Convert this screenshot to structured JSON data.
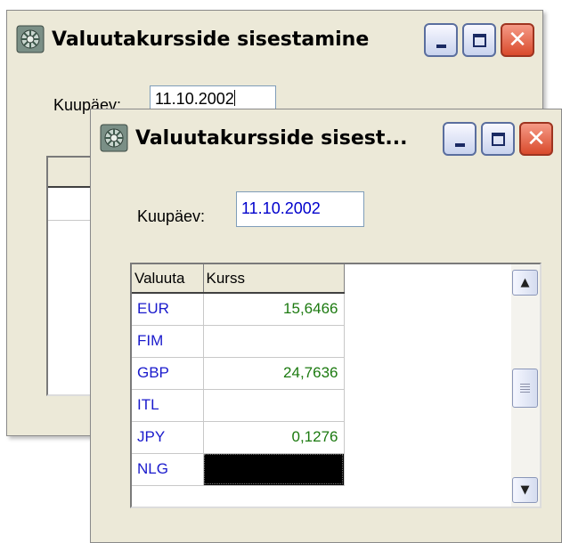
{
  "back_window": {
    "title": "Valuutakursside sisestamine",
    "date_label": "Kuupäev:",
    "date_value": "11.10.2002"
  },
  "front_window": {
    "title": "Valuutakursside sisest...",
    "date_label": "Kuupäev:",
    "date_value": "11.10.2002",
    "grid": {
      "columns": [
        "Valuuta",
        "Kurss"
      ],
      "rows": [
        {
          "currency": "EUR",
          "rate": "15,6466"
        },
        {
          "currency": "FIM",
          "rate": ""
        },
        {
          "currency": "GBP",
          "rate": "24,7636"
        },
        {
          "currency": "ITL",
          "rate": ""
        },
        {
          "currency": "JPY",
          "rate": "0,1276"
        },
        {
          "currency": "NLG",
          "rate": ""
        }
      ]
    }
  },
  "icons": [
    "app-icon",
    "minimize-icon",
    "maximize-icon",
    "close-icon",
    "scroll-up-icon",
    "scroll-down-icon"
  ],
  "colors": {
    "currency_text": "#1a1acc",
    "rate_text": "#1c7a10",
    "close_button": "#d94a2c",
    "selected_cell": "#000000"
  }
}
